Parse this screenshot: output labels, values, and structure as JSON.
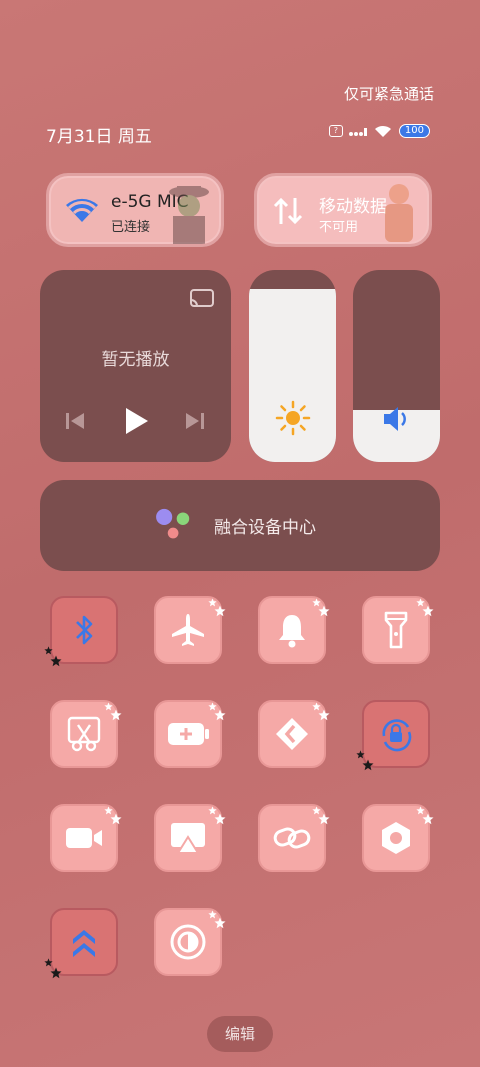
{
  "header": {
    "emergency_text": "仅可紧急通话",
    "date_text": "7月31日 周五",
    "battery_level": "100"
  },
  "wifi": {
    "name": "e-5G   MIC",
    "status": "已连接"
  },
  "mobile_data": {
    "name": "移动数据",
    "status": "不可用"
  },
  "media": {
    "title": "暂无播放"
  },
  "sliders": {
    "brightness_level": 0.9,
    "volume_level": 0.27
  },
  "fusion": {
    "label": "融合设备中心"
  },
  "tiles": [
    {
      "icon": "bluetooth-icon",
      "active": true
    },
    {
      "icon": "airplane-icon",
      "active": false
    },
    {
      "icon": "bell-icon",
      "active": false
    },
    {
      "icon": "flashlight-icon",
      "active": false
    },
    {
      "icon": "screenshot-cut-icon",
      "active": false
    },
    {
      "icon": "battery-saver-icon",
      "active": false
    },
    {
      "icon": "kdrive-icon",
      "active": false
    },
    {
      "icon": "rotation-lock-icon",
      "active": true
    },
    {
      "icon": "video-camera-icon",
      "active": false
    },
    {
      "icon": "screen-cast-icon",
      "active": false
    },
    {
      "icon": "link-icon",
      "active": false
    },
    {
      "icon": "nut-icon",
      "active": false
    },
    {
      "icon": "chevrons-up-icon",
      "active": true
    },
    {
      "icon": "contrast-icon",
      "active": false
    }
  ],
  "edit_label": "编辑",
  "colors": {
    "accent": "#3b78e7",
    "tile": "#f5a9a7",
    "tile_active": "#d97373",
    "panel": "#7b4e4e"
  }
}
